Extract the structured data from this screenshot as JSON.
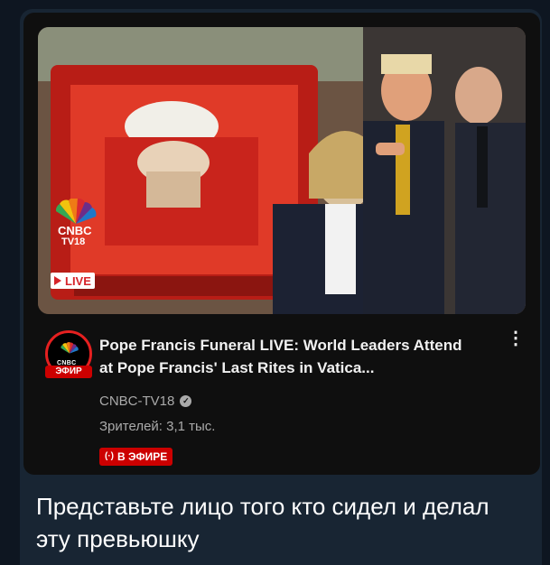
{
  "thumbnail": {
    "logo_text": "CNBC",
    "logo_sub": "TV18",
    "live_badge": "LIVE"
  },
  "video": {
    "title": "Pope Francis Funeral LIVE: World Leaders Attend at Pope Francis' Last Rites in Vatica...",
    "channel": "CNBC-TV18",
    "verified_icon": "check-icon",
    "viewers": "Зрителей: 3,1 тыс.",
    "on_air_label": "В ЭФИРЕ",
    "on_air_glyph": "(·)",
    "menu_glyph": "⋮"
  },
  "avatar": {
    "label": "CNBC",
    "live_label": "ЭФИР"
  },
  "message": {
    "text": "Представьте лицо того кто сидел и делал эту превьюшку"
  },
  "colors": {
    "app_bg": "#0e1621",
    "bubble_bg": "#182533",
    "card_bg": "#0f0f0f",
    "live_red": "#cc0000"
  }
}
